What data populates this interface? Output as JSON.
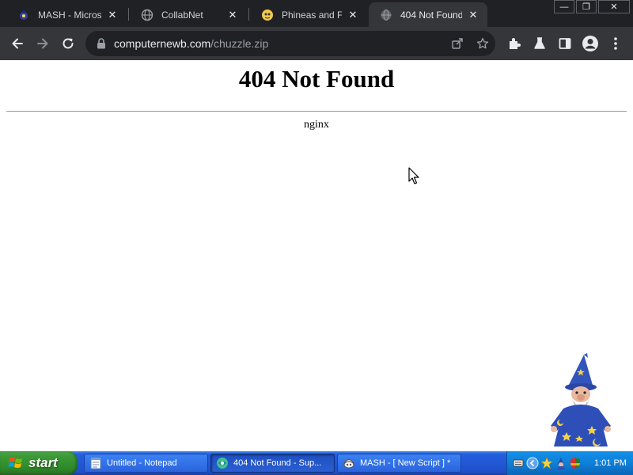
{
  "browser": {
    "tabs": [
      {
        "title": "MASH - Microsoft",
        "favicon": "mash-icon",
        "active": false
      },
      {
        "title": "CollabNet",
        "favicon": "globe-icon",
        "active": false
      },
      {
        "title": "Phineas and Ferb",
        "favicon": "phineas-icon",
        "active": false
      },
      {
        "title": "404 Not Found",
        "favicon": "globe-icon",
        "active": true
      }
    ],
    "window_controls": {
      "minimize": "—",
      "restore": "❐",
      "close": "✕"
    },
    "address_bar": {
      "domain": "computernewb.com",
      "path": "/chuzzle.zip"
    }
  },
  "page": {
    "heading": "404 Not Found",
    "server": "nginx"
  },
  "taskbar": {
    "start_label": "start",
    "tasks": [
      {
        "label": "Untitled - Notepad",
        "icon": "notepad-icon",
        "active": false
      },
      {
        "label": "404 Not Found - Sup...",
        "icon": "browser-icon",
        "active": true
      },
      {
        "label": "MASH - [ New Script ] *",
        "icon": "mash-icon",
        "active": false
      }
    ],
    "clock": "1:01 PM"
  },
  "colors": {
    "tabstrip": "#202124",
    "toolbar": "#35363a",
    "omnibox": "#202124",
    "taskbar_blue": "#245edb",
    "start_green": "#3c9a37",
    "tray_blue": "#0f7fd6"
  }
}
